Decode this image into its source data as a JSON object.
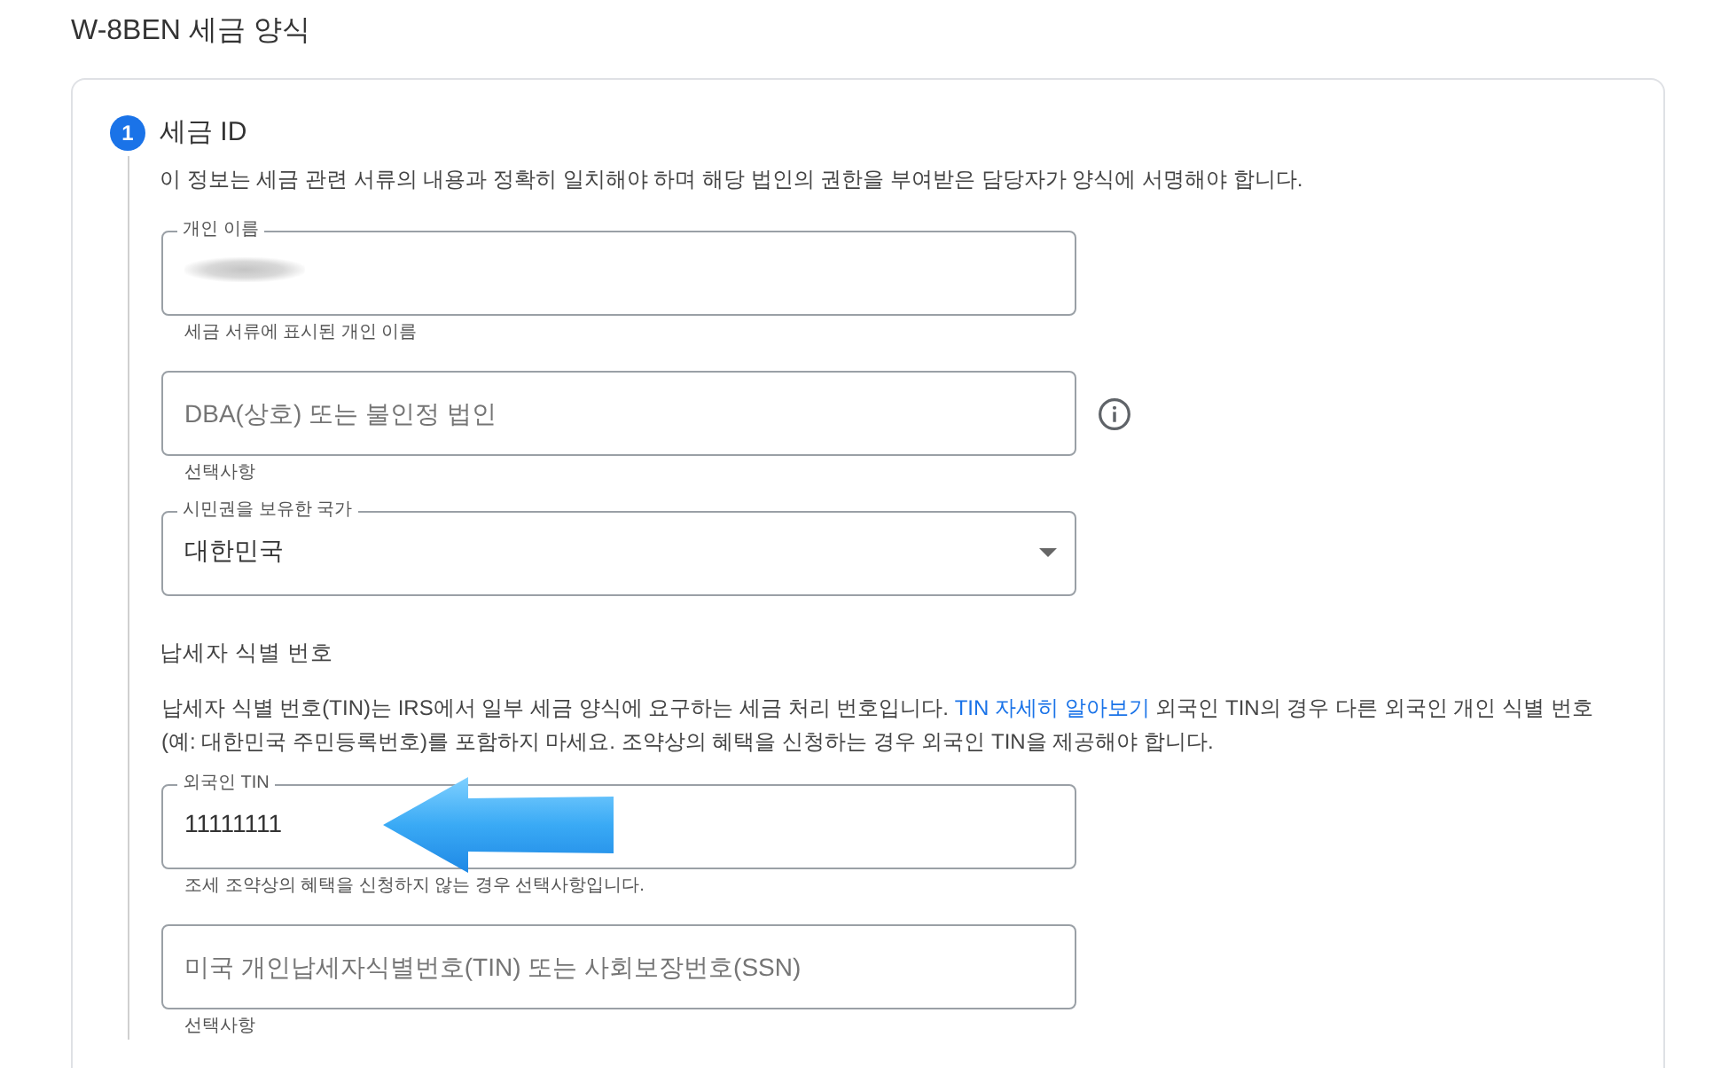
{
  "page": {
    "title": "W-8BEN 세금 양식"
  },
  "step": {
    "number": "1",
    "title": "세금 ID",
    "description": "이 정보는 세금 관련 서류의 내용과 정확히 일치해야 하며 해당 법인의 권한을 부여받은 담당자가 양식에 서명해야 합니다."
  },
  "fields": [
    {
      "kind": "text",
      "label": "개인 이름",
      "redacted": true,
      "info": false,
      "helper": "세금 서류에 표시된 개인 이름"
    },
    {
      "kind": "text",
      "placeholder": "DBA(상호) 또는 불인정 법인",
      "redacted": false,
      "info": true,
      "helper": "선택사항"
    },
    {
      "kind": "select",
      "label": "시민권을 보유한 국가",
      "value": "대한민국",
      "redacted": false,
      "info": false
    }
  ],
  "tin": {
    "heading": "납세자 식별 번호",
    "description_before": "납세자 식별 번호(TIN)는 IRS에서 일부 세금 양식에 요구하는 세금 처리 번호입니다.",
    "link": "TIN 자세히 알아보기",
    "description_after": "외국인 TIN의 경우 다른 외국인 개인 식별 번호(예: 대한민국 주민등록번호)를 포함하지 마세요. 조약상의 혜택을 신청하는 경우 외국인 TIN을 제공해야 합니다.",
    "fields": [
      {
        "kind": "text",
        "label": "외국인 TIN",
        "value": "11111111",
        "redacted": false,
        "info": false,
        "helper": "조세 조약상의 혜택을 신청하지 않는 경우 선택사항입니다."
      },
      {
        "kind": "text",
        "placeholder": "미국 개인납세자식별번호(TIN) 또는 사회보장번호(SSN)",
        "redacted": false,
        "info": false,
        "helper": "선택사항"
      }
    ]
  }
}
